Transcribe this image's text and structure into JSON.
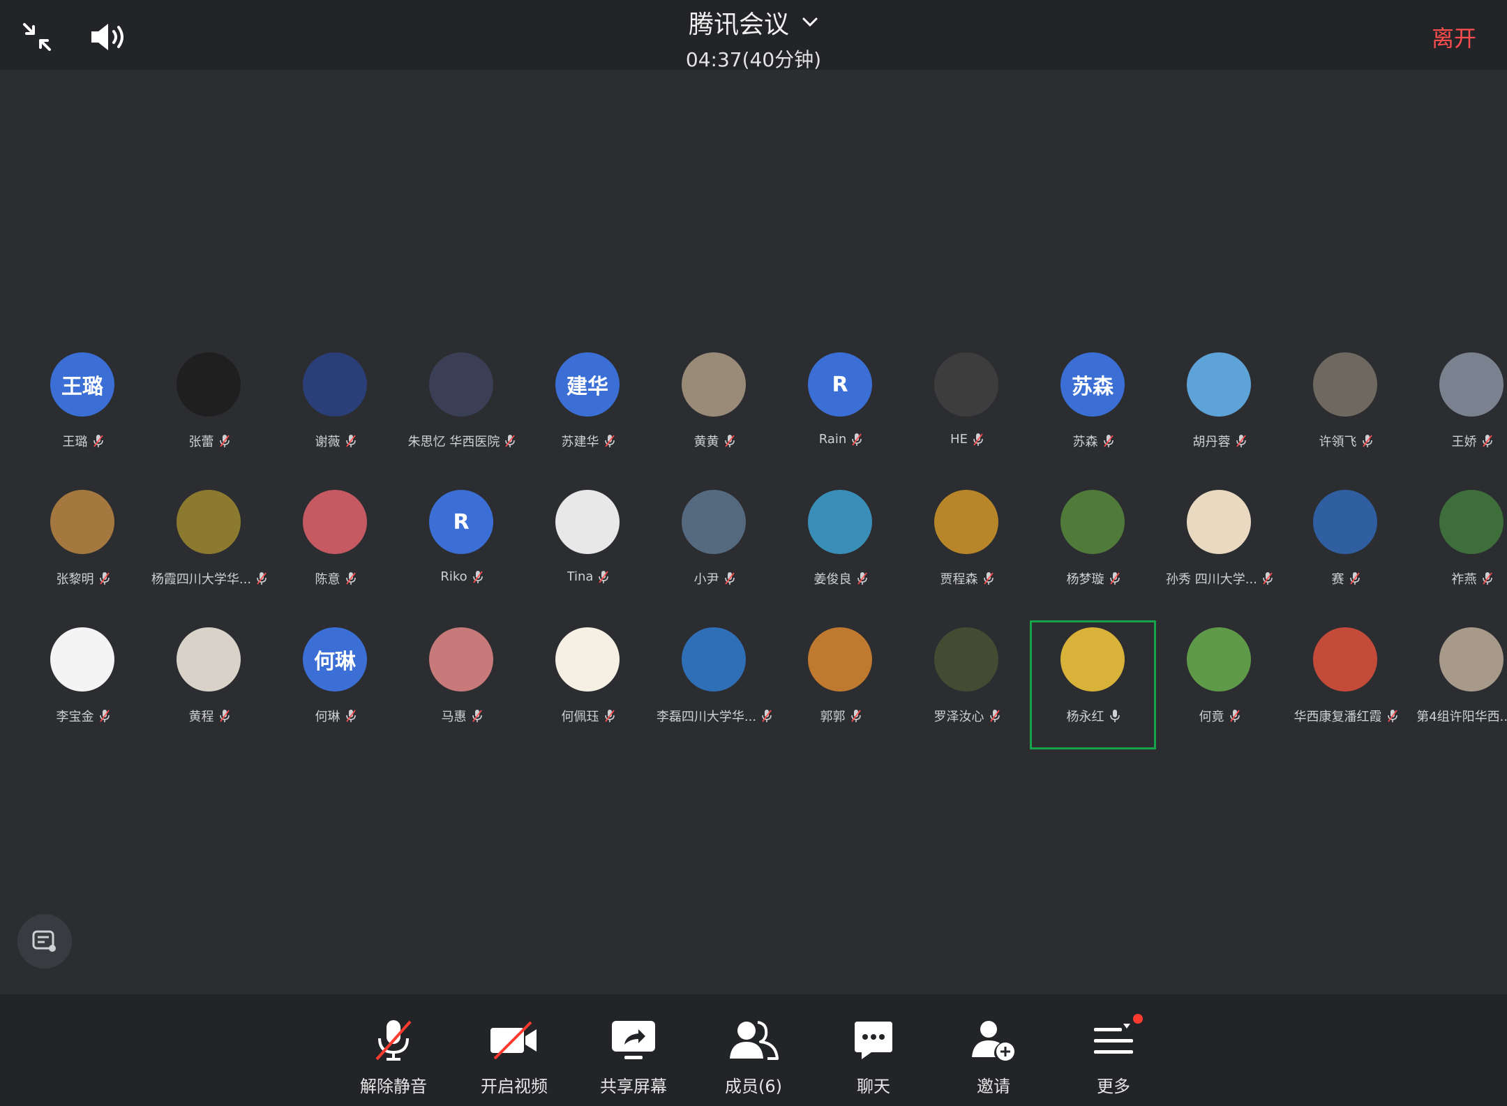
{
  "header": {
    "title": "腾讯会议",
    "timer": "04:37(40分钟)",
    "leave": "离开",
    "icons": [
      "collapse-icon",
      "speaker-icon",
      "chevron-down-icon"
    ]
  },
  "participants": [
    [
      {
        "avatar_text": "王璐",
        "name": "王璐",
        "bg": "#3b6fd6"
      },
      {
        "avatar_text": "",
        "name": "张蕾",
        "bg": "#1f1f1f"
      },
      {
        "avatar_text": "",
        "name": "谢薇",
        "bg": "#2a3f78"
      },
      {
        "avatar_text": "",
        "name": "朱思忆 华西医院",
        "bg": "#3a3f55"
      },
      {
        "avatar_text": "建华",
        "name": "苏建华",
        "bg": "#3b6fd6"
      },
      {
        "avatar_text": "",
        "name": "黄黄",
        "bg": "#9a8a78"
      },
      {
        "avatar_text": "R",
        "name": "Rain",
        "bg": "#3b6fd6"
      },
      {
        "avatar_text": "",
        "name": "HE",
        "bg": "#3d3d3d"
      },
      {
        "avatar_text": "苏森",
        "name": "苏森",
        "bg": "#3b6fd6"
      },
      {
        "avatar_text": "",
        "name": "胡丹蓉",
        "bg": "#5ea3d8"
      },
      {
        "avatar_text": "",
        "name": "许領飞",
        "bg": "#6f6860"
      },
      {
        "avatar_text": "",
        "name": "王娇",
        "bg": "#7a8290"
      }
    ],
    [
      {
        "avatar_text": "",
        "name": "张黎明",
        "bg": "#a4783e"
      },
      {
        "avatar_text": "",
        "name": "杨霞四川大学华...",
        "bg": "#8c7a2e"
      },
      {
        "avatar_text": "",
        "name": "陈意",
        "bg": "#c55a63"
      },
      {
        "avatar_text": "R",
        "name": "Riko",
        "bg": "#3b6fd6"
      },
      {
        "avatar_text": "",
        "name": "Tina",
        "bg": "#e8e8e8"
      },
      {
        "avatar_text": "",
        "name": "小尹",
        "bg": "#556a7e"
      },
      {
        "avatar_text": "",
        "name": "姜俊良",
        "bg": "#3a8fb8"
      },
      {
        "avatar_text": "",
        "name": "贾程森",
        "bg": "#b8862a"
      },
      {
        "avatar_text": "",
        "name": "杨梦璇",
        "bg": "#4f7a3a"
      },
      {
        "avatar_text": "",
        "name": "孙秀 四川大学...",
        "bg": "#e8d9c0"
      },
      {
        "avatar_text": "",
        "name": "赛",
        "bg": "#2f5fa0"
      },
      {
        "avatar_text": "",
        "name": "祚燕",
        "bg": "#3e6e3a"
      }
    ],
    [
      {
        "avatar_text": "",
        "name": "李宝金",
        "bg": "#f4f4f4"
      },
      {
        "avatar_text": "",
        "name": "黄程",
        "bg": "#d8d2c8"
      },
      {
        "avatar_text": "何琳",
        "name": "何琳",
        "bg": "#3b6fd6"
      },
      {
        "avatar_text": "",
        "name": "马惠",
        "bg": "#c87a7a"
      },
      {
        "avatar_text": "",
        "name": "何佩珏",
        "bg": "#f6f0e4"
      },
      {
        "avatar_text": "",
        "name": "李磊四川大学华...",
        "bg": "#2f6fb8"
      },
      {
        "avatar_text": "",
        "name": "郭郭",
        "bg": "#c07a30"
      },
      {
        "avatar_text": "",
        "name": "罗泽汝心",
        "bg": "#454a32"
      },
      {
        "avatar_text": "",
        "name": "杨永红",
        "bg": "#d9b23a",
        "active": true
      },
      {
        "avatar_text": "",
        "name": "何竟",
        "bg": "#5f9a48"
      },
      {
        "avatar_text": "",
        "name": "华西康复潘红霞",
        "bg": "#c44a3a"
      },
      {
        "avatar_text": "",
        "name": "第4组许阳华西...",
        "bg": "#a89a8a"
      }
    ]
  ],
  "toolbar": [
    {
      "label": "解除静音",
      "icon": "mic-muted-icon"
    },
    {
      "label": "开启视频",
      "icon": "video-off-icon"
    },
    {
      "label": "共享屏幕",
      "icon": "share-screen-icon"
    },
    {
      "label": "成员(6)",
      "icon": "members-icon"
    },
    {
      "label": "聊天",
      "icon": "chat-icon"
    },
    {
      "label": "邀请",
      "icon": "invite-icon"
    },
    {
      "label": "更多",
      "icon": "more-icon"
    }
  ],
  "colors": {
    "accent_red": "#ff4d4f",
    "active_border": "#16a34a",
    "avatar_blue": "#3b6fd6"
  }
}
